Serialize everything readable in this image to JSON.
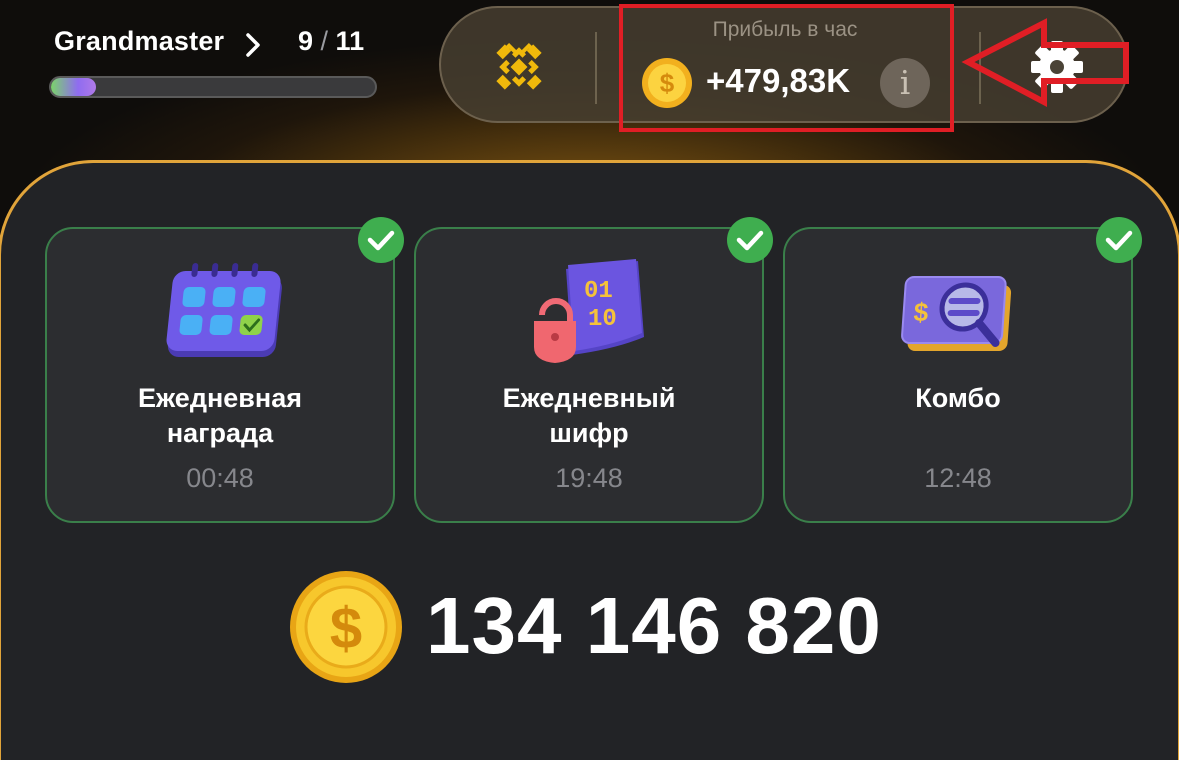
{
  "rank": {
    "name": "Grandmaster",
    "current": "9",
    "separator": " / ",
    "total": "11",
    "progress_fraction": 0.14
  },
  "profit": {
    "label": "Прибыль в час",
    "value": "+479,83K",
    "info": "i"
  },
  "icons": {
    "exchange": "binance-logo-icon",
    "settings": "gear-icon",
    "coin": "gold-dollar-coin-icon"
  },
  "cards": [
    {
      "title_line1": "Ежедневная",
      "title_line2": "награда",
      "time": "00:48",
      "completed": true,
      "icon": "calendar-icon"
    },
    {
      "title_line1": "Ежедневный",
      "title_line2": "шифр",
      "time": "19:48",
      "completed": true,
      "icon": "cipher-lock-icon"
    },
    {
      "title_line1": "Комбо",
      "title_line2": "",
      "time": "12:48",
      "completed": true,
      "icon": "combo-magnifier-card-icon"
    }
  ],
  "balance": "134 146 820",
  "colors": {
    "accent_gold": "#e1a43a",
    "check_green": "#3fae4f",
    "highlight_red": "#e01e25",
    "exchange_yellow": "#f0b90b"
  }
}
